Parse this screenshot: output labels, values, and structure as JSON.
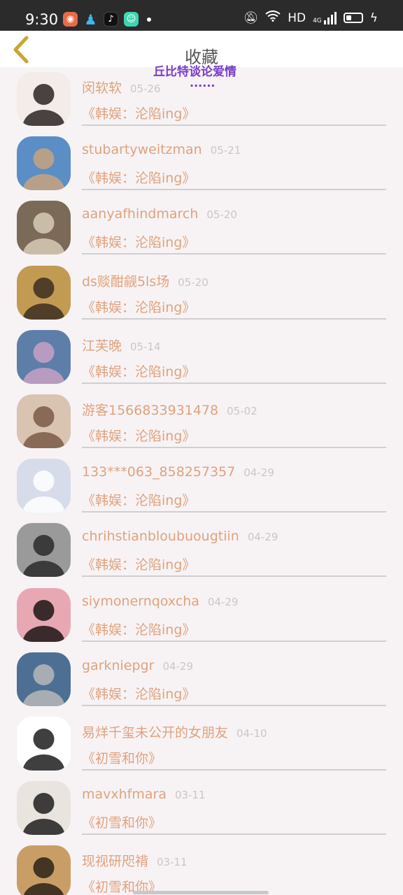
{
  "status_bar": {
    "time": "9:30",
    "network": "HD",
    "cellular": "4G"
  },
  "header": {
    "title": "收藏",
    "overlay_text": "丘比特谈论爱情",
    "overlay_dots": "......"
  },
  "favorites": [
    {
      "name": "闵软软",
      "date": "05-26",
      "title": "《韩娱：沦陷ing》",
      "avatar_colors": [
        "#f3ece8",
        "#2a2423"
      ]
    },
    {
      "name": "stubartyweitzman",
      "date": "05-21",
      "title": "《韩娱：沦陷ing》",
      "avatar_colors": [
        "#5a8ec5",
        "#c9a27f"
      ]
    },
    {
      "name": "aanyafhindmarch",
      "date": "05-20",
      "title": "《韩娱：沦陷ing》",
      "avatar_colors": [
        "#7b6a57",
        "#d8cbb6"
      ]
    },
    {
      "name": "ds赕酣觎5ls场",
      "date": "05-20",
      "title": "《韩娱：沦陷ing》",
      "avatar_colors": [
        "#c29a52",
        "#3d2e22"
      ]
    },
    {
      "name": "江芙晚",
      "date": "05-14",
      "title": "《韩娱：沦陷ing》",
      "avatar_colors": [
        "#5d7ea8",
        "#c8a0c6"
      ]
    },
    {
      "name": "游客1566833931478",
      "date": "05-02",
      "title": "《韩娱：沦陷ing》",
      "avatar_colors": [
        "#d9c3b1",
        "#7a5a46"
      ]
    },
    {
      "name": "133***063_858257357",
      "date": "04-29",
      "title": "《韩娱：沦陷ing》",
      "avatar_colors": [
        "#d6dcea",
        "#ffffff"
      ]
    },
    {
      "name": "chrihstianbloubuougtiin",
      "date": "04-29",
      "title": "《韩娱：沦陷ing》",
      "avatar_colors": [
        "#9a9a9a",
        "#2a2a2a"
      ]
    },
    {
      "name": "siymonernqoxcha",
      "date": "04-29",
      "title": "《韩娱：沦陷ing》",
      "avatar_colors": [
        "#e7a8b4",
        "#1c1414"
      ]
    },
    {
      "name": "garkniepgr",
      "date": "04-29",
      "title": "《韩娱：沦陷ing》",
      "avatar_colors": [
        "#4d6f93",
        "#b9b9b9"
      ]
    },
    {
      "name": "易烊千玺未公开的女朋友",
      "date": "04-10",
      "title": "《初雪和你》",
      "avatar_colors": [
        "#ffffff",
        "#1d1d1d"
      ]
    },
    {
      "name": "mavxhfmara",
      "date": "03-11",
      "title": "《初雪和你》",
      "avatar_colors": [
        "#e9e4de",
        "#1f1f1f"
      ]
    },
    {
      "name": "现视研咫褙",
      "date": "03-11",
      "title": "《初雪和你》",
      "avatar_colors": [
        "#c99e66",
        "#2b2118"
      ]
    }
  ],
  "colors": {
    "accent": "#e0a27c",
    "date": "#c7c7c7",
    "background": "#f7f3f5",
    "overlay": "#7a3cc8",
    "back_arrow": "#c8a635"
  }
}
